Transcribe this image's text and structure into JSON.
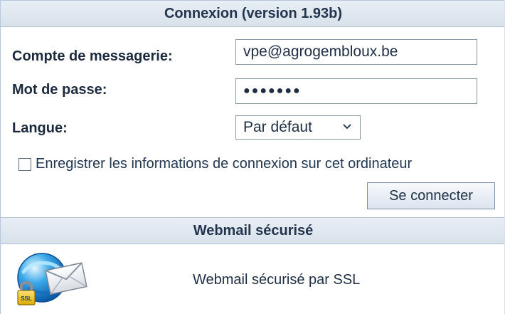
{
  "login": {
    "header": "Connexion (version 1.93b)",
    "email_label": "Compte de messagerie:",
    "email_value": "vpe@agrogembloux.be",
    "password_label": "Mot de passe:",
    "password_mask": "●●●●●●●",
    "language_label": "Langue:",
    "language_value": "Par défaut",
    "remember_label": "Enregistrer les informations de connexion sur cet ordinateur",
    "connect_button": "Se connecter"
  },
  "secure": {
    "header": "Webmail sécurisé",
    "description": "Webmail sécurisé par SSL",
    "icon_badge": "SSL"
  },
  "colors": {
    "header_background": "#dfe7f1",
    "header_text": "#23354d",
    "label_text": "#1c2a3e",
    "field_border": "#8b98aa"
  },
  "icons": {
    "dropdown": "chevron-down-icon",
    "secure_mail": "ssl-mail-icon",
    "checkbox": "checkbox-icon"
  }
}
